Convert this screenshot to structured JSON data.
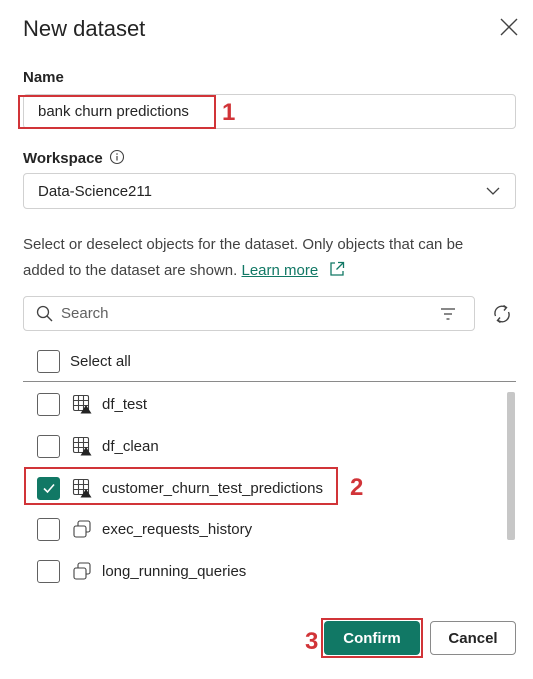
{
  "dialog": {
    "title": "New dataset"
  },
  "name_field": {
    "label": "Name",
    "value": "bank churn predictions"
  },
  "workspace_field": {
    "label": "Workspace",
    "value": "Data-Science211"
  },
  "description": {
    "text": "Select or deselect objects for the dataset. Only objects that can be added to the dataset are shown.",
    "link_text": "Learn more"
  },
  "search": {
    "placeholder": "Search"
  },
  "select_all": {
    "label": "Select all",
    "checked": false
  },
  "items": [
    {
      "label": "df_test",
      "icon": "table-icon",
      "checked": false
    },
    {
      "label": "df_clean",
      "icon": "table-icon",
      "checked": false
    },
    {
      "label": "customer_churn_test_predictions",
      "icon": "table-icon",
      "checked": true
    },
    {
      "label": "exec_requests_history",
      "icon": "view-icon",
      "checked": false
    },
    {
      "label": "long_running_queries",
      "icon": "view-icon",
      "checked": false
    }
  ],
  "buttons": {
    "confirm": "Confirm",
    "cancel": "Cancel"
  },
  "annotations": {
    "step1": "1",
    "step2": "2",
    "step3": "3"
  },
  "colors": {
    "accent": "#117865",
    "highlight": "#d13438"
  }
}
